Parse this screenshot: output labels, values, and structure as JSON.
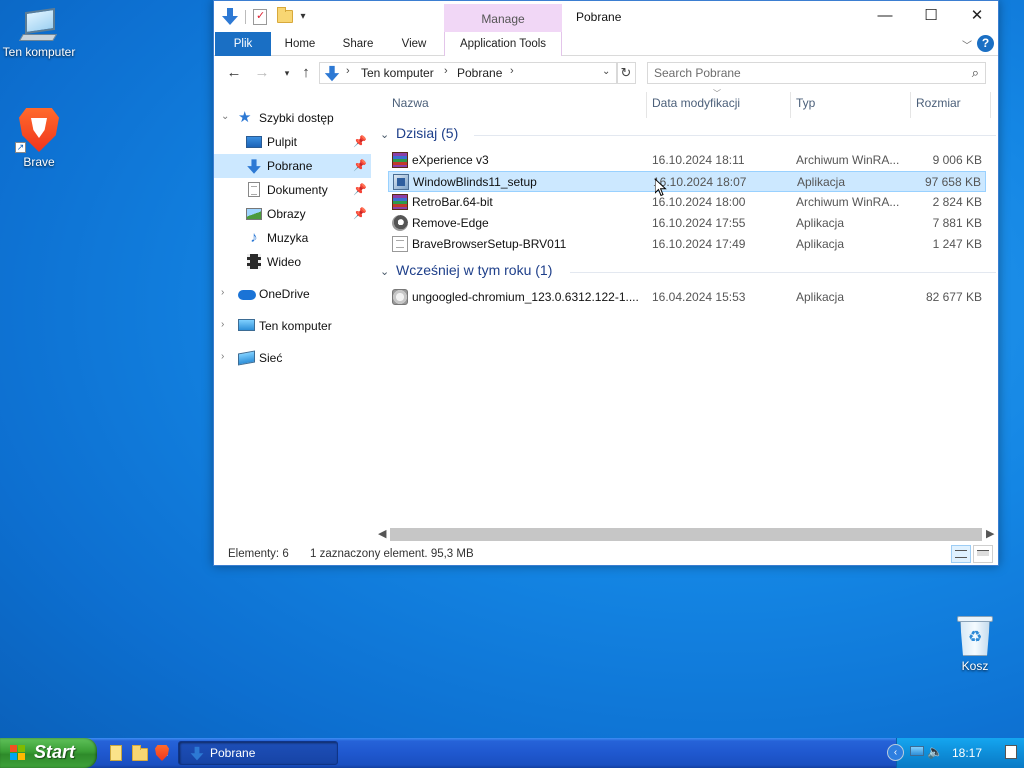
{
  "desktop": {
    "icons": [
      {
        "label": "Ten komputer",
        "icon": "computer-icon"
      },
      {
        "label": "Brave",
        "icon": "brave-icon"
      },
      {
        "label": "Kosz",
        "icon": "recycle-bin-icon"
      }
    ]
  },
  "window": {
    "title": "Pobrane",
    "context_tab": "Manage",
    "caption": {
      "minimize": "—",
      "maximize": "☐",
      "close": "✕"
    },
    "ribbon_tabs": [
      "Plik",
      "Home",
      "Share",
      "View",
      "Application Tools"
    ],
    "help": "?",
    "address": {
      "crumbs": [
        "Ten komputer",
        "Pobrane"
      ],
      "search_placeholder": "Search Pobrane"
    },
    "nav": [
      {
        "label": "Szybki dostęp",
        "icon": "star-icon",
        "expanded": true
      },
      {
        "label": "Pulpit",
        "icon": "desktop-folder-icon",
        "pinned": true
      },
      {
        "label": "Pobrane",
        "icon": "downloads-icon",
        "pinned": true,
        "selected": true
      },
      {
        "label": "Dokumenty",
        "icon": "documents-icon",
        "pinned": true
      },
      {
        "label": "Obrazy",
        "icon": "pictures-icon",
        "pinned": true
      },
      {
        "label": "Muzyka",
        "icon": "music-icon"
      },
      {
        "label": "Wideo",
        "icon": "video-icon"
      },
      {
        "label": "OneDrive",
        "icon": "onedrive-icon"
      },
      {
        "label": "Ten komputer",
        "icon": "computer-icon"
      },
      {
        "label": "Sieć",
        "icon": "network-icon"
      }
    ],
    "columns": [
      "Nazwa",
      "Data modyfikacji",
      "Typ",
      "Rozmiar"
    ],
    "groups": [
      {
        "title": "Dzisiaj (5)",
        "files": [
          {
            "name": "eXperience v3",
            "date": "16.10.2024 18:11",
            "type": "Archiwum WinRA...",
            "size": "9 006 KB",
            "icon": "winrar-archive-icon"
          },
          {
            "name": "WindowBlinds11_setup",
            "date": "16.10.2024 18:07",
            "type": "Aplikacja",
            "size": "97 658 KB",
            "icon": "windowblinds-app-icon",
            "selected": true
          },
          {
            "name": "RetroBar.64-bit",
            "date": "16.10.2024 18:00",
            "type": "Archiwum WinRA...",
            "size": "2 824 KB",
            "icon": "winrar-archive-icon"
          },
          {
            "name": "Remove-Edge",
            "date": "16.10.2024 17:55",
            "type": "Aplikacja",
            "size": "7 881 KB",
            "icon": "remove-edge-app-icon"
          },
          {
            "name": "BraveBrowserSetup-BRV011",
            "date": "16.10.2024 17:49",
            "type": "Aplikacja",
            "size": "1 247 KB",
            "icon": "app-generic-icon"
          }
        ]
      },
      {
        "title": "Wcześniej w tym roku (1)",
        "files": [
          {
            "name": "ungoogled-chromium_123.0.6312.122-1....",
            "date": "16.04.2024 15:53",
            "type": "Aplikacja",
            "size": "82 677 KB",
            "icon": "setup-app-icon"
          }
        ]
      }
    ],
    "status": {
      "count": "Elementy: 6",
      "selection": "1 zaznaczony element. 95,3 MB"
    }
  },
  "taskbar": {
    "start_label": "Start",
    "task_label": "Pobrane",
    "clock": "18:17"
  },
  "colors": {
    "accent": "#1a6fc4",
    "selection": "#cce8ff",
    "taskbar": "#1f58cf",
    "start": "#3a9e35"
  }
}
